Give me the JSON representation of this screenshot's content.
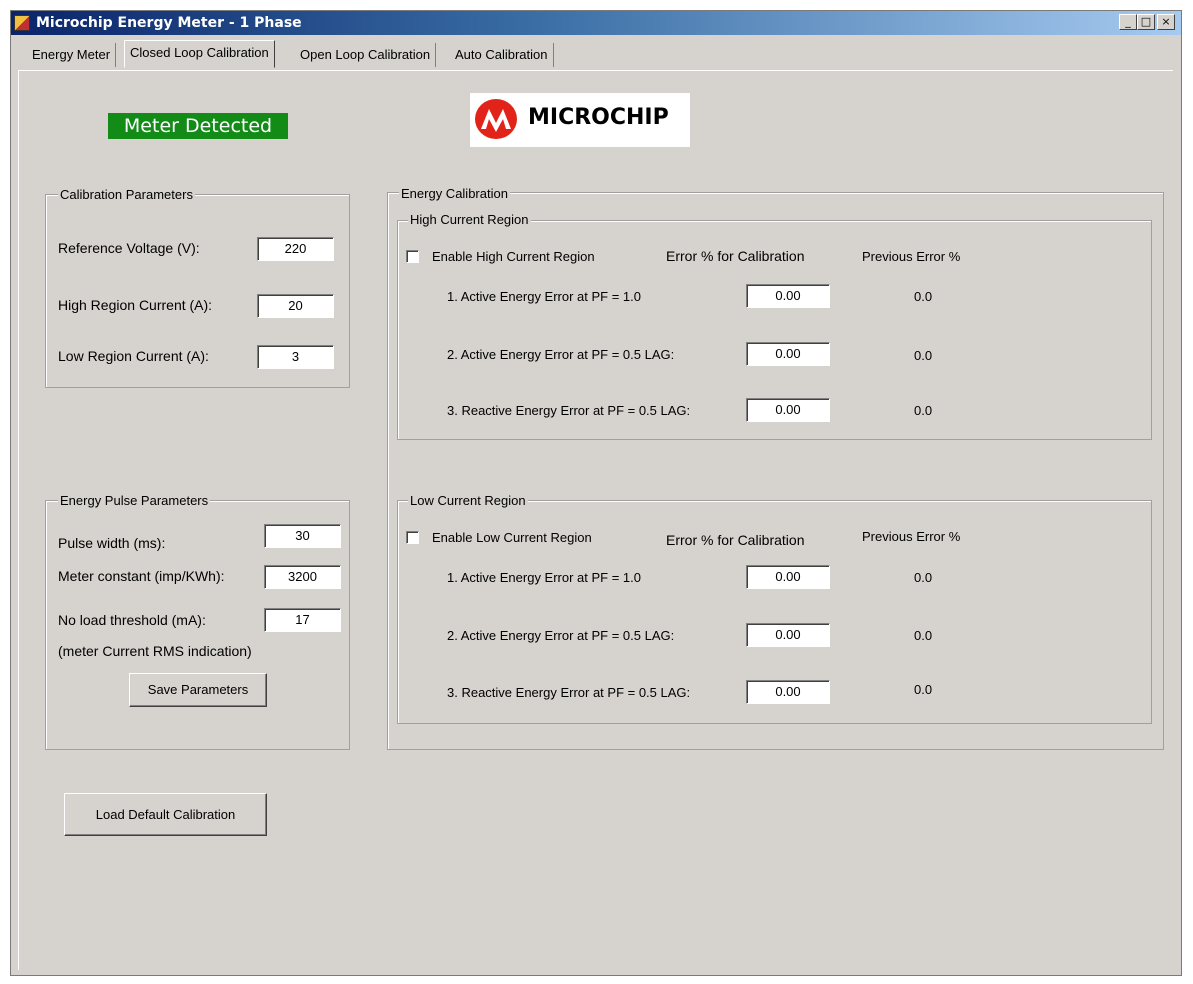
{
  "window": {
    "title": "Microchip Energy Meter - 1 Phase",
    "min": "_",
    "max": "□",
    "close": "×"
  },
  "tabs": [
    "Energy Meter",
    "Closed Loop Calibration",
    "Open Loop Calibration",
    "Auto Calibration"
  ],
  "status": "Meter Detected",
  "logo_text": "MICROCHIP",
  "calibration_parameters": {
    "title": "Calibration Parameters",
    "ref_voltage_label": "Reference Voltage (V):",
    "ref_voltage": "220",
    "high_current_label": "High Region Current (A):",
    "high_current": "20",
    "low_current_label": "Low Region Current (A):",
    "low_current": "3"
  },
  "pulse_parameters": {
    "title": "Energy Pulse Parameters",
    "pulse_width_label": "Pulse width (ms):",
    "pulse_width": "30",
    "meter_constant_label": "Meter constant (imp/KWh):",
    "meter_constant": "3200",
    "no_load_label": "No load threshold (mA):",
    "no_load": "17",
    "no_load_note": "(meter Current RMS indication)",
    "save_button": "Save Parameters"
  },
  "load_default_button": "Load Default Calibration",
  "energy_calibration": {
    "title": "Energy Calibration",
    "high": {
      "title": "High Current Region",
      "enable_label": "Enable High Current Region",
      "error_header": "Error % for Calibration",
      "prev_header": "Previous Error %",
      "rows": [
        {
          "label": "1. Active Energy Error at PF = 1.0",
          "value": "0.00",
          "prev": "0.0"
        },
        {
          "label": "2. Active Energy Error at PF = 0.5 LAG:",
          "value": "0.00",
          "prev": "0.0"
        },
        {
          "label": "3. Reactive Energy Error at PF = 0.5 LAG:",
          "value": "0.00",
          "prev": "0.0"
        }
      ]
    },
    "low": {
      "title": "Low Current Region",
      "enable_label": "Enable Low Current Region",
      "error_header": "Error % for Calibration",
      "prev_header": "Previous Error %",
      "rows": [
        {
          "label": "1. Active Energy Error at PF = 1.0",
          "value": "0.00",
          "prev": "0.0"
        },
        {
          "label": "2. Active Energy Error at PF = 0.5 LAG:",
          "value": "0.00",
          "prev": "0.0"
        },
        {
          "label": "3. Reactive Energy Error at PF = 0.5 LAG:",
          "value": "0.00",
          "prev": "0.0"
        }
      ]
    }
  }
}
